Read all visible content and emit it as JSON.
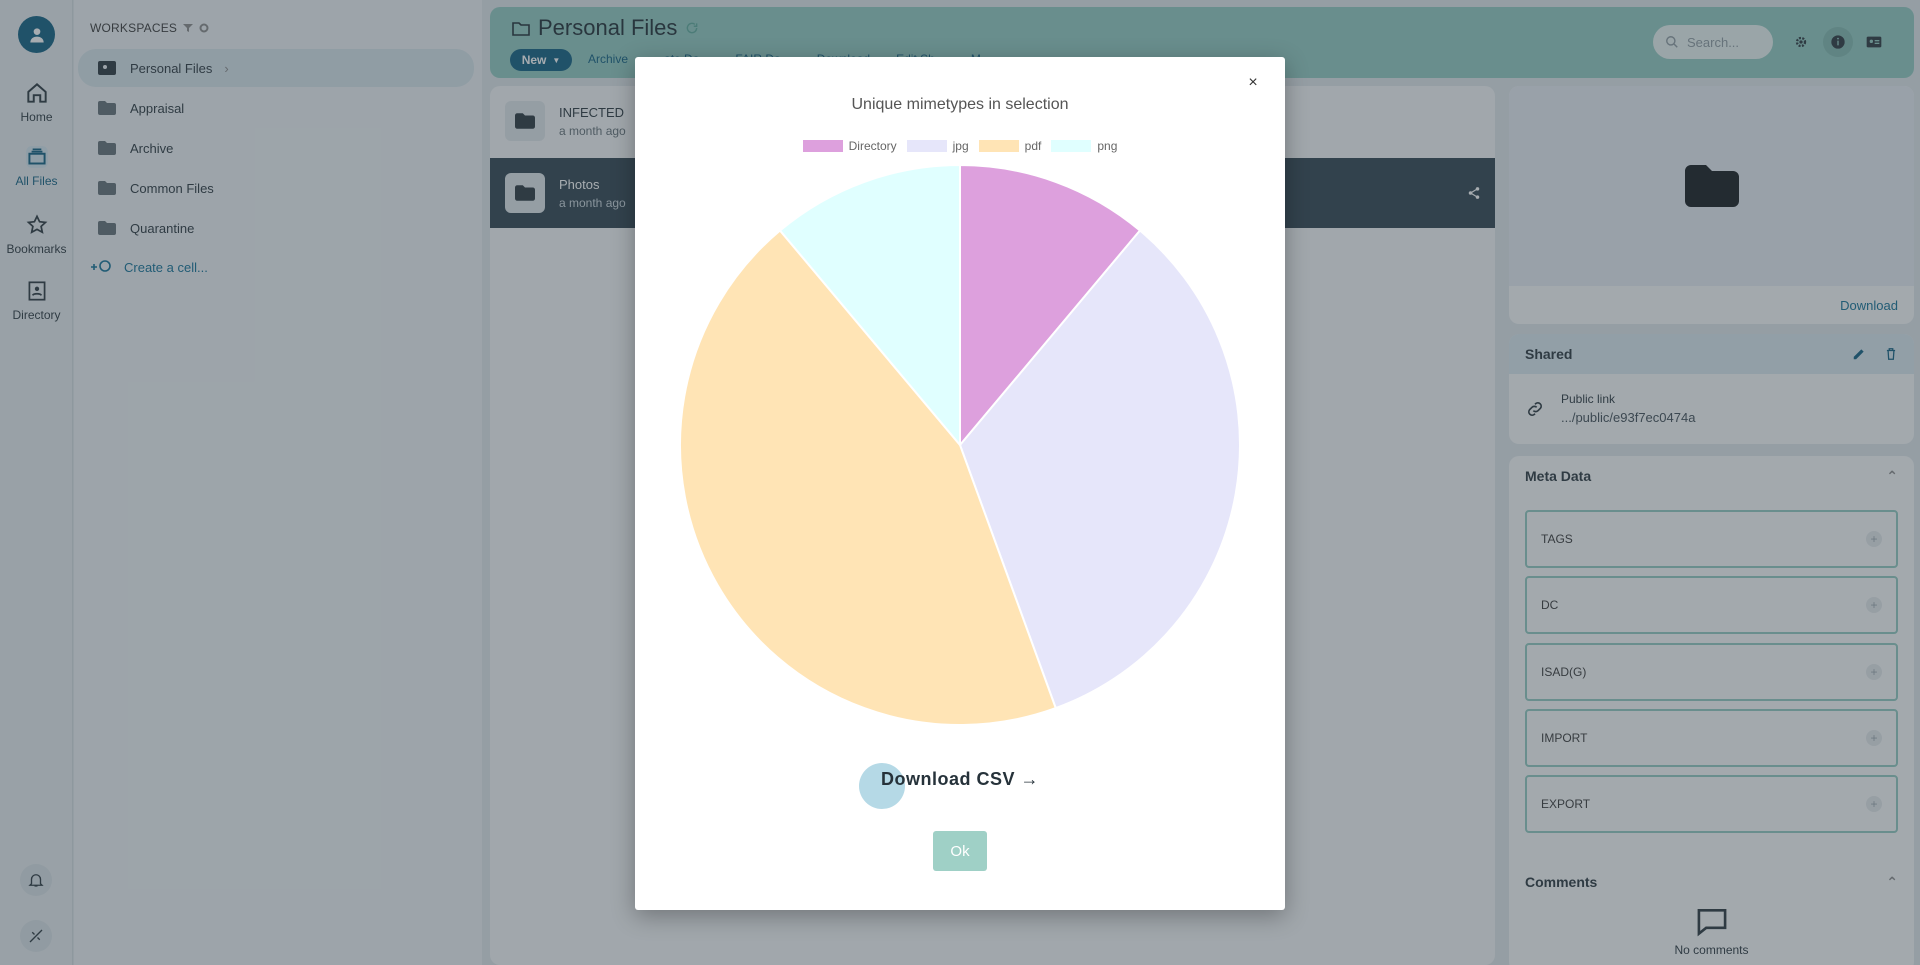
{
  "rail": {
    "items": [
      {
        "label": "Home",
        "icon": "home-icon"
      },
      {
        "label": "All Files",
        "icon": "files-icon"
      },
      {
        "label": "Bookmarks",
        "icon": "star-icon"
      },
      {
        "label": "Directory",
        "icon": "directory-icon"
      }
    ]
  },
  "sidebar": {
    "title": "WORKSPACES",
    "items": [
      {
        "label": "Personal Files"
      },
      {
        "label": "Appraisal"
      },
      {
        "label": "Archive"
      },
      {
        "label": "Common Files"
      },
      {
        "label": "Quarantine"
      }
    ],
    "create_label": "Create a cell..."
  },
  "header": {
    "title": "Personal Files",
    "new_label": "New",
    "actions": [
      "Archive",
      "...ate Da...",
      "FAIR Da...",
      "Download",
      "Edit Sh...",
      "M..."
    ],
    "search_placeholder": "Search..."
  },
  "files": [
    {
      "name": "INFECTED",
      "date": "a month ago"
    },
    {
      "name": "Photos",
      "date": "a month ago"
    }
  ],
  "right_panel": {
    "download_label": "Download",
    "shared_title": "Shared",
    "public_link_label": "Public link",
    "public_link_value": ".../public/e93f7ec0474a",
    "meta_title": "Meta Data",
    "meta_fields": [
      "TAGS",
      "DC",
      "ISAD(G)",
      "IMPORT",
      "EXPORT"
    ],
    "comments_title": "Comments",
    "no_comments": "No comments"
  },
  "modal": {
    "close_label": "×",
    "csv_label": "Download CSV →",
    "ok_label": "Ok"
  },
  "chart_data": {
    "type": "pie",
    "title": "Unique mimetypes in selection",
    "legend_position": "top",
    "categories": [
      "Directory",
      "jpg",
      "pdf",
      "png"
    ],
    "values": [
      1,
      3,
      4,
      1
    ],
    "colors": [
      "#dda0dd",
      "#e6e6fa",
      "#ffe4b5",
      "#e0ffff"
    ]
  },
  "colors": {
    "brand": "#0a5b7f",
    "header_bg": "#8fc9bf",
    "selected_row": "#2a3f4c"
  }
}
